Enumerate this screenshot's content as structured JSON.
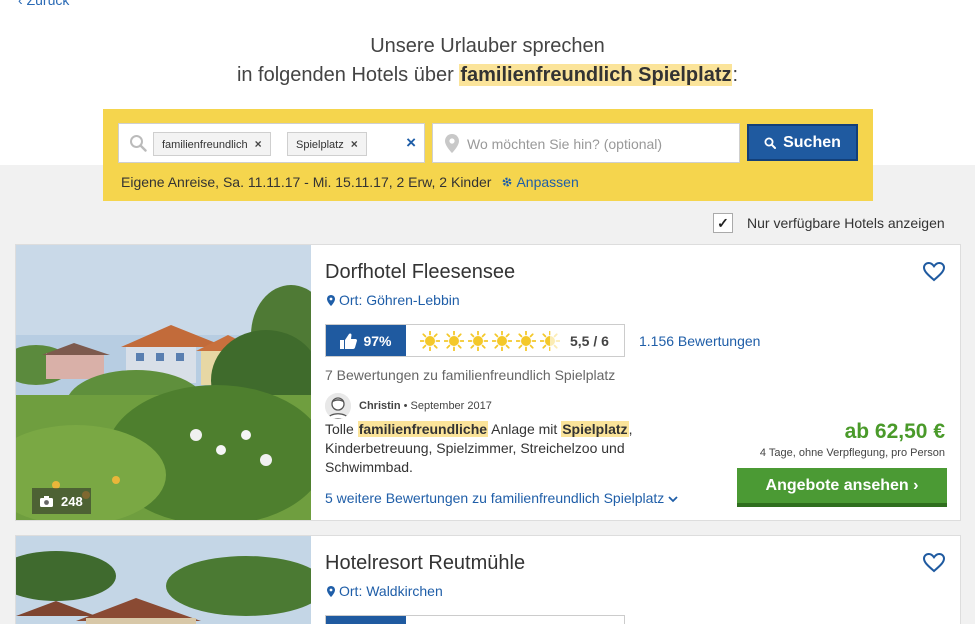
{
  "nav": {
    "back_label": "Zurück"
  },
  "header": {
    "line1": "Unsere Urlauber sprechen",
    "line2_prefix": "in folgenden Hotels über",
    "topic": "familienfreundlich Spielplatz",
    "line2_suffix": ":"
  },
  "search": {
    "tags": [
      "familienfreundlich",
      "Spielplatz"
    ],
    "tag_remove_glyph": "×",
    "clear_glyph": "×",
    "location_placeholder": "Wo möchten Sie hin? (optional)",
    "submit_label": "Suchen",
    "travel_info": "Eigene Anreise, Sa. 11.11.17 - Mi. 15.11.17, 2 Erw, 2 Kinder",
    "adjust_label": "Anpassen"
  },
  "filter": {
    "only_available_label": "Nur verfügbare Hotels anzeigen",
    "only_available_checked": true
  },
  "hotels": [
    {
      "name": "Dorfhotel Fleesensee",
      "location": "Ort: Göhren-Lebbin",
      "photo_count": "248",
      "recommendation": "97%",
      "suns": 5.5,
      "score": "5,5 / 6",
      "reviews_count": "1.156 Bewertungen",
      "topic_reviews": "7 Bewertungen zu familienfreundlich Spielplatz",
      "reviewer_name": "Christin",
      "reviewer_sep": " • ",
      "reviewer_date": "September 2017",
      "review": {
        "part1": "Tolle ",
        "hl1": "familienfreundliche",
        "part2": " Anlage mit ",
        "hl2": "Spielplatz",
        "part3": ", Kinderbetreuung, Spielzimmer, Streichelzoo und Schwimmbad."
      },
      "more_reviews": "5 weitere Bewertungen zu familienfreundlich Spielplatz",
      "price": "ab 62,50 €",
      "price_note": "4 Tage, ohne Verpflegung, pro Person",
      "offer_button": "Angebote ansehen ›"
    },
    {
      "name": "Hotelresort Reutmühle",
      "location": "Ort: Waldkirchen"
    }
  ],
  "colors": {
    "accent_blue": "#1f5aa0",
    "highlight_yellow": "#f5d54d",
    "price_green": "#4a9a2a",
    "button_green": "#4b9a34"
  }
}
